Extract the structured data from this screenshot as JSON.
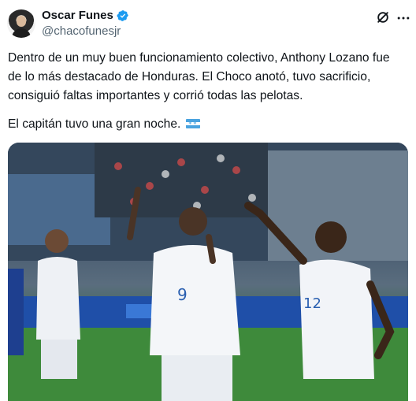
{
  "author": {
    "name": "Oscar Funes",
    "handle": "@chacofunesjr",
    "verified": true,
    "avatar_icon": "profile-avatar"
  },
  "actions": {
    "grok_icon": "grok-icon",
    "more_icon": "more-options-icon"
  },
  "tweet": {
    "paragraph_1": "Dentro de un muy buen funcionamiento colectivo, Anthony Lozano fue\nde lo más destacado de Honduras. El Choco anotó, tuvo sacrificio,\nconsiguió faltas importantes y corrió todas las pelotas.",
    "paragraph_2": "El capitán tuvo una gran noche.",
    "emoji": "honduras-flag"
  },
  "media": {
    "type": "photo",
    "description_icon": "football-celebration-photo"
  },
  "colors": {
    "verified": "#1d9bf0",
    "text": "#0f1419",
    "secondary": "#536471"
  }
}
